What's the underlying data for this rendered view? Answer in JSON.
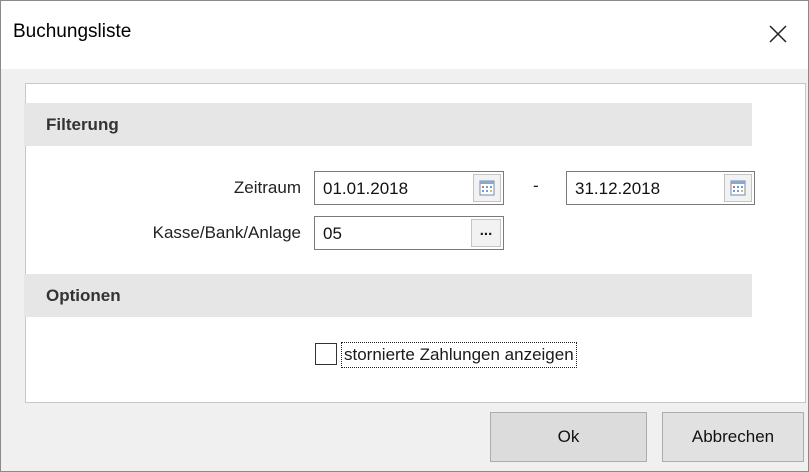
{
  "window": {
    "title": "Buchungsliste",
    "close_icon": "close-icon"
  },
  "filter_section": {
    "header": "Filterung",
    "zeitraum_label": "Zeitraum",
    "date_from": "01.01.2018",
    "date_separator": "-",
    "date_to": "31.12.2018",
    "kasse_label": "Kasse/Bank/Anlage",
    "kasse_value": "05",
    "browse_label": "..."
  },
  "options_section": {
    "header": "Optionen",
    "show_cancelled_label": "stornierte Zahlungen anzeigen",
    "show_cancelled_checked": false
  },
  "buttons": {
    "ok": "Ok",
    "cancel": "Abbrechen"
  },
  "colors": {
    "section_bg": "#e6e6e6",
    "title_bg": "#ffffff",
    "dialog_bg": "#f0f0f0"
  }
}
